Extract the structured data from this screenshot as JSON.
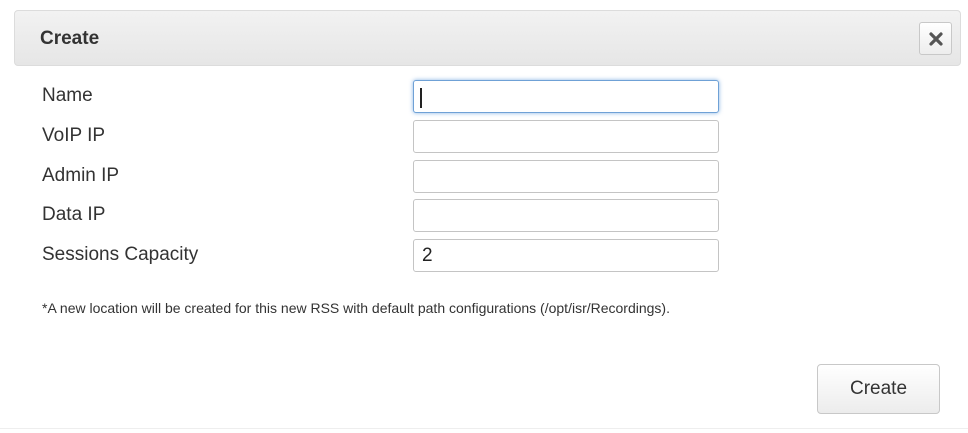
{
  "dialog": {
    "title": "Create",
    "close_icon": "close-icon"
  },
  "form": {
    "fields": [
      {
        "label": "Name",
        "value": "",
        "focused": true
      },
      {
        "label": "VoIP IP",
        "value": ""
      },
      {
        "label": "Admin IP",
        "value": ""
      },
      {
        "label": "Data IP",
        "value": ""
      },
      {
        "label": "Sessions Capacity",
        "value": "2"
      }
    ],
    "note": "*A new location will be created for this new RSS with default path configurations (/opt/isr/Recordings)."
  },
  "actions": {
    "create_label": "Create"
  }
}
